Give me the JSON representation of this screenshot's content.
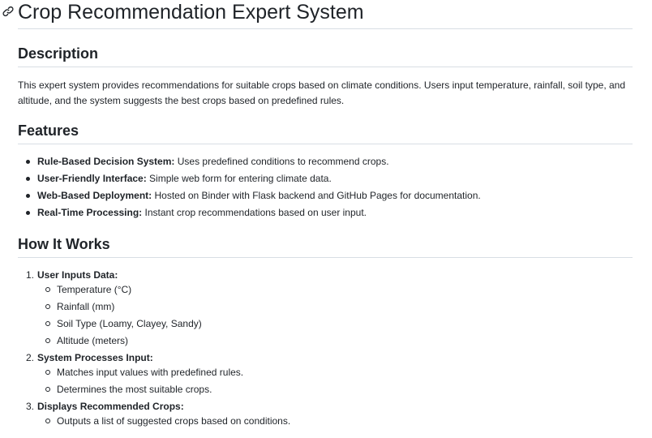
{
  "page": {
    "title": "Crop Recommendation Expert System"
  },
  "description": {
    "heading": "Description",
    "text": "This expert system provides recommendations for suitable crops based on climate conditions. Users input temperature, rainfall, soil type, and altitude, and the system suggests the best crops based on predefined rules."
  },
  "features": {
    "heading": "Features",
    "items": [
      {
        "label": "Rule-Based Decision System:",
        "text": " Uses predefined conditions to recommend crops."
      },
      {
        "label": "User-Friendly Interface:",
        "text": " Simple web form for entering climate data."
      },
      {
        "label": "Web-Based Deployment:",
        "text": " Hosted on Binder with Flask backend and GitHub Pages for documentation."
      },
      {
        "label": "Real-Time Processing:",
        "text": " Instant crop recommendations based on user input."
      }
    ]
  },
  "how_it_works": {
    "heading": "How It Works",
    "steps": [
      {
        "number": "1.",
        "label": "User Inputs Data:",
        "items": [
          "Temperature (°C)",
          "Rainfall (mm)",
          "Soil Type (Loamy, Clayey, Sandy)",
          "Altitude (meters)"
        ]
      },
      {
        "number": "2.",
        "label": "System Processes Input:",
        "items": [
          "Matches input values with predefined rules.",
          "Determines the most suitable crops."
        ]
      },
      {
        "number": "3.",
        "label": "Displays Recommended Crops:",
        "items": [
          "Outputs a list of suggested crops based on conditions."
        ]
      }
    ]
  },
  "icons": {
    "anchor": "link-icon"
  }
}
